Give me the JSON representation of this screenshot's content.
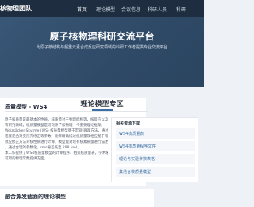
{
  "nav": {
    "logo": "核物理团队",
    "links": [
      "首页",
      "理论模型",
      "会议信息",
      "科研人员",
      "科研"
    ]
  },
  "hero": {
    "title": "原子核物理科研交流平台",
    "subtitle": "为原子核结构与超重元素合成反应研究领域的科研工作者提供专业交流平台"
  },
  "section": {
    "title": "理论模型专区"
  },
  "model_card": {
    "title": "质量模型 - WS4",
    "body": [
      "原子核质量是最基本的性质，核质量对于物理结构等，核反应以及核天体物理",
      "等研究领域，核质量模型是研究原子核物理一个重要理论框架。",
      "Weizsäcker-Skyrme (WS) 核质量模型基于宏观-微观方法，通过Skyrme能量",
      "密度泛函对变形壳修正等参数，能够精确描述核质量及相应基于程度，考虑多",
      "效应修正方法对核性质进行计算，模型能对现有核素质量进行描述...",
      "，通过合理的参数化，rms偏差低至 298 keV。",
      "本工作提供了WS4核质量模型的计算程序、相关核质量表，学术报告",
      "可用的物理常数提供方面。"
    ]
  },
  "sidebar": {
    "title": "相关资源下载",
    "items": [
      "WS4核质量表",
      "WS4核质量程序文件",
      "理论与实验参数表格",
      "其他合核质量模型"
    ]
  },
  "model_card2": {
    "title": "融合蒸发截面的理论模型"
  }
}
